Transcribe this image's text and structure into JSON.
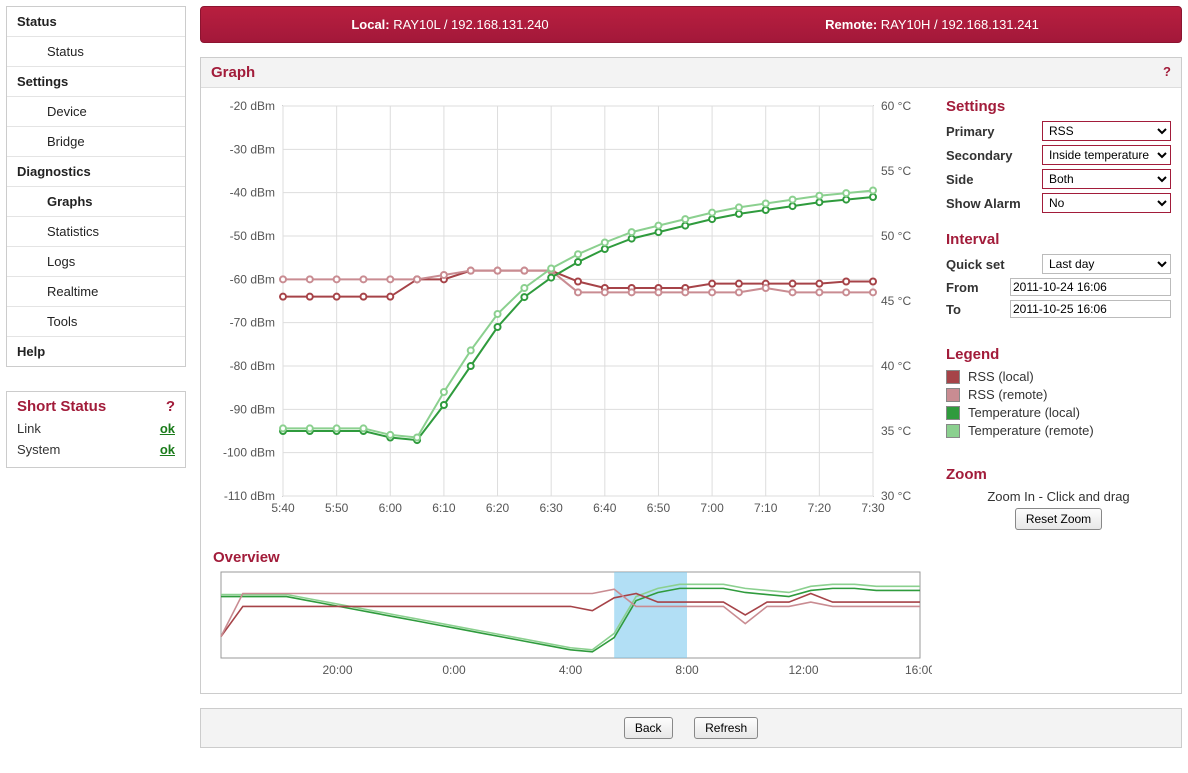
{
  "topbar": {
    "local_lbl": "Local:",
    "local_val": "RAY10L / 192.168.131.240",
    "remote_lbl": "Remote:",
    "remote_val": "RAY10H / 192.168.131.241"
  },
  "nav": {
    "status": "Status",
    "status_sub": "Status",
    "settings": "Settings",
    "device": "Device",
    "bridge": "Bridge",
    "diagnostics": "Diagnostics",
    "graphs": "Graphs",
    "statistics": "Statistics",
    "logs": "Logs",
    "realtime": "Realtime",
    "tools": "Tools",
    "help": "Help"
  },
  "short_status": {
    "title": "Short Status",
    "help": "?",
    "rows": [
      {
        "k": "Link",
        "v": "ok"
      },
      {
        "k": "System",
        "v": "ok"
      }
    ]
  },
  "card": {
    "title": "Graph",
    "help": "?"
  },
  "settings_panel": {
    "title": "Settings",
    "primary_lbl": "Primary",
    "primary_val": "RSS",
    "secondary_lbl": "Secondary",
    "secondary_val": "Inside temperature",
    "side_lbl": "Side",
    "side_val": "Both",
    "alarm_lbl": "Show Alarm",
    "alarm_val": "No"
  },
  "interval_panel": {
    "title": "Interval",
    "quick_lbl": "Quick set",
    "quick_val": "Last day",
    "from_lbl": "From",
    "from_val": "2011-10-24 16:06",
    "to_lbl": "To",
    "to_val": "2011-10-25 16:06"
  },
  "legend_panel": {
    "title": "Legend",
    "items": [
      {
        "label": "RSS (local)",
        "color": "#a64348"
      },
      {
        "label": "RSS (remote)",
        "color": "#c98c92"
      },
      {
        "label": "Temperature (local)",
        "color": "#2f9b3d"
      },
      {
        "label": "Temperature (remote)",
        "color": "#8bd08f"
      }
    ]
  },
  "zoom_panel": {
    "title": "Zoom",
    "hint": "Zoom In - Click and drag",
    "reset": "Reset Zoom"
  },
  "overview_title": "Overview",
  "footer": {
    "back": "Back",
    "refresh": "Refresh"
  },
  "chart_data": {
    "type": "line",
    "title": "",
    "x_ticks": [
      "5:40",
      "5:50",
      "6:00",
      "6:10",
      "6:20",
      "6:30",
      "6:40",
      "6:50",
      "7:00",
      "7:10",
      "7:20",
      "7:30"
    ],
    "y1_label_suffix": "dBm",
    "y1_ticks": [
      -20,
      -30,
      -40,
      -50,
      -60,
      -70,
      -80,
      -90,
      -100,
      -110
    ],
    "y1_range": [
      -110,
      -20
    ],
    "y2_label_suffix": "°C",
    "y2_ticks": [
      30,
      35,
      40,
      45,
      50,
      55,
      60
    ],
    "y2_range": [
      30,
      60
    ],
    "series": [
      {
        "name": "RSS (local)",
        "axis": "y1",
        "color": "#a64348",
        "values": [
          -64,
          -64,
          -64,
          -64,
          -64,
          -60,
          -60,
          -58,
          -58,
          -58,
          -58,
          -60.5,
          -62,
          -62,
          -62,
          -62,
          -61,
          -61,
          -61,
          -61,
          -61,
          -60.5,
          -60.5
        ]
      },
      {
        "name": "RSS (remote)",
        "axis": "y1",
        "color": "#c98c92",
        "values": [
          -60,
          -60,
          -60,
          -60,
          -60,
          -60,
          -59,
          -58,
          -58,
          -58,
          -58,
          -63,
          -63,
          -63,
          -63,
          -63,
          -63,
          -63,
          -62,
          -63,
          -63,
          -63,
          -63
        ]
      },
      {
        "name": "Temperature (local)",
        "axis": "y2",
        "color": "#2f9b3d",
        "values": [
          35,
          35,
          35,
          35,
          34.5,
          34.3,
          37,
          40,
          43,
          45.3,
          46.8,
          48,
          49,
          49.8,
          50.3,
          50.8,
          51.3,
          51.7,
          52,
          52.3,
          52.6,
          52.8,
          53
        ]
      },
      {
        "name": "Temperature (remote)",
        "axis": "y2",
        "color": "#8bd08f",
        "values": [
          35.2,
          35.2,
          35.2,
          35.2,
          34.7,
          34.5,
          38,
          41.2,
          44,
          46,
          47.5,
          48.6,
          49.5,
          50.3,
          50.8,
          51.3,
          51.8,
          52.2,
          52.5,
          52.8,
          53.1,
          53.3,
          53.5
        ]
      }
    ],
    "x_positions_count": 23
  },
  "overview_data": {
    "type": "line",
    "x_ticks": [
      "20:00",
      "0:00",
      "4:00",
      "8:00",
      "12:00",
      "16:00"
    ],
    "x_range_hours": [
      16,
      40
    ],
    "selection_hours": [
      29.5,
      32
    ],
    "series": [
      {
        "name": "temp_local",
        "color": "#2f9b3d",
        "values": [
          48,
          48,
          48,
          48,
          47,
          46,
          45,
          44,
          43,
          42,
          41,
          40,
          39,
          38,
          37,
          36,
          35,
          34.5,
          38,
          47,
          49,
          50,
          50,
          50,
          49,
          48.5,
          48,
          49.5,
          50,
          50,
          49.5,
          49.5,
          49.5
        ]
      },
      {
        "name": "temp_remote",
        "color": "#8bd08f",
        "values": [
          48.5,
          48.5,
          48.5,
          48.5,
          47.5,
          46.5,
          45.5,
          44.5,
          43.5,
          42.5,
          41.5,
          40.5,
          39.5,
          38.5,
          37.5,
          36.5,
          35.5,
          35,
          39,
          48,
          50,
          51,
          51,
          51,
          50,
          49.5,
          49,
          50.5,
          51,
          51,
          50.5,
          50.5,
          50.5
        ]
      },
      {
        "name": "rss_local",
        "color": "#a64348",
        "values": [
          -70,
          -63,
          -63,
          -63,
          -63,
          -63,
          -63,
          -63,
          -63,
          -63,
          -63,
          -63,
          -63,
          -63,
          -63,
          -63,
          -63,
          -64,
          -61,
          -60,
          -62,
          -62,
          -62,
          -62,
          -65,
          -62,
          -62,
          -60,
          -62,
          -62,
          -62,
          -62,
          -62
        ]
      },
      {
        "name": "rss_remote",
        "color": "#c98c92",
        "values": [
          -70,
          -60,
          -60,
          -60,
          -60,
          -60,
          -60,
          -60,
          -60,
          -60,
          -60,
          -60,
          -60,
          -60,
          -60,
          -60,
          -60,
          -60,
          -59,
          -63,
          -63,
          -63,
          -63,
          -63,
          -67,
          -63,
          -63,
          -62,
          -63,
          -63,
          -63,
          -63,
          -63
        ]
      }
    ]
  }
}
